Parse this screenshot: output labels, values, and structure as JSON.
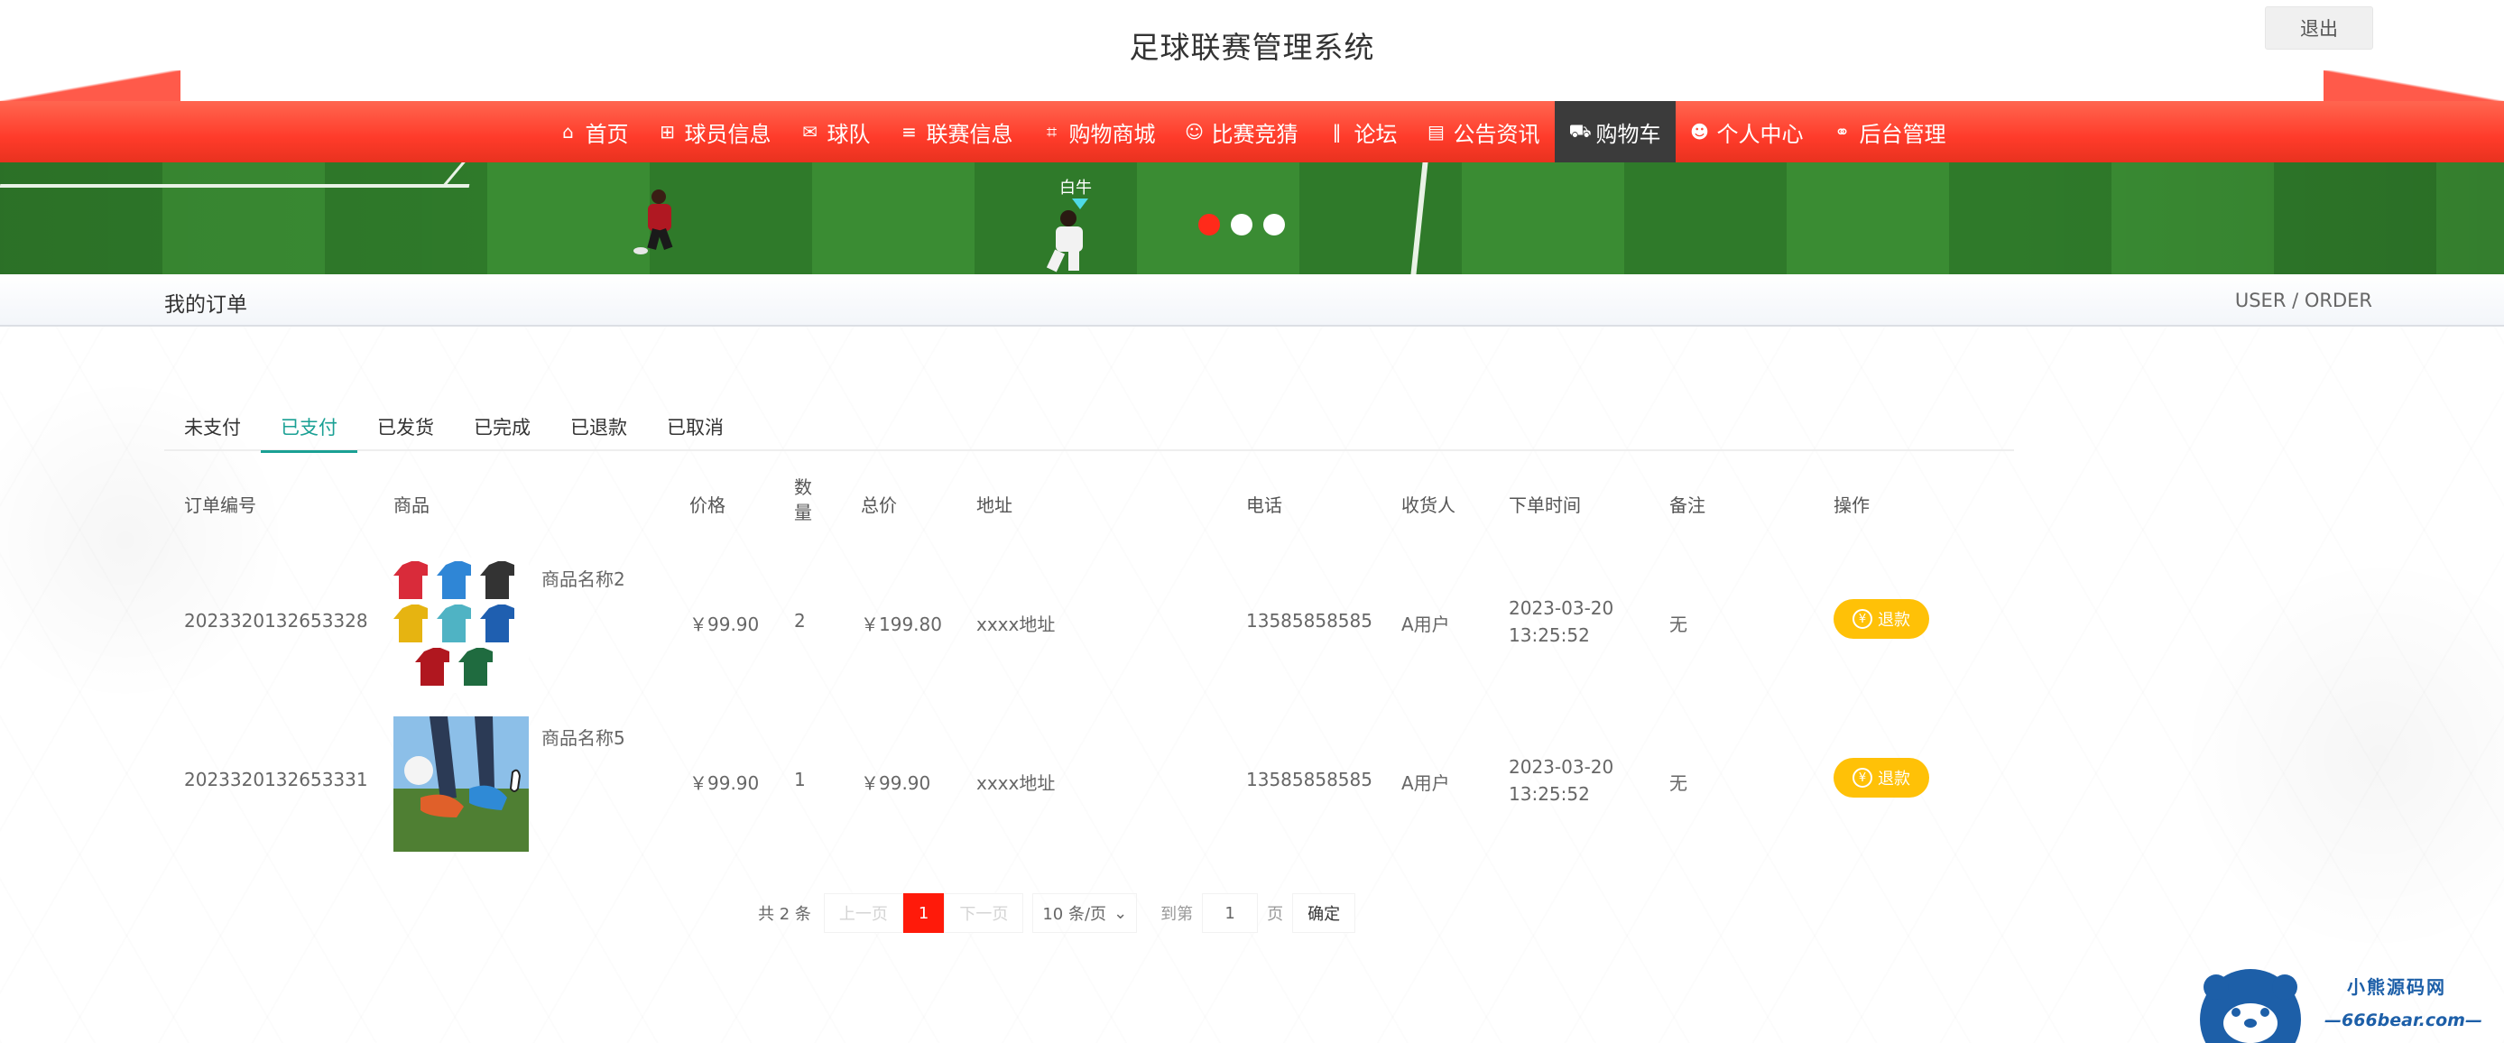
{
  "header": {
    "title": "足球联赛管理系统",
    "logout_label": "退出"
  },
  "nav": {
    "items": [
      {
        "label": "首页",
        "icon": "home-icon",
        "glyph": "⌂"
      },
      {
        "label": "球员信息",
        "icon": "gift-icon",
        "glyph": "⊞"
      },
      {
        "label": "球队",
        "icon": "mail-icon",
        "glyph": "✉"
      },
      {
        "label": "联赛信息",
        "icon": "sliders-icon",
        "glyph": "≡"
      },
      {
        "label": "购物商城",
        "icon": "tag-icon",
        "glyph": "⌗"
      },
      {
        "label": "比赛竞猜",
        "icon": "gamepad-icon",
        "glyph": "☺"
      },
      {
        "label": "论坛",
        "icon": "columns-icon",
        "glyph": "‖"
      },
      {
        "label": "公告资讯",
        "icon": "book-icon",
        "glyph": "▤"
      },
      {
        "label": "购物车",
        "icon": "cart-icon",
        "glyph": "⛟"
      },
      {
        "label": "个人中心",
        "icon": "user-icon",
        "glyph": "☻"
      },
      {
        "label": "后台管理",
        "icon": "link-icon",
        "glyph": "⚭"
      }
    ],
    "active_index": 8
  },
  "banner": {
    "player_tag": "白牛"
  },
  "breadcrumb": {
    "title": "我的订单",
    "path": "USER / ORDER"
  },
  "tabs": {
    "items": [
      "未支付",
      "已支付",
      "已发货",
      "已完成",
      "已退款",
      "已取消"
    ],
    "active_index": 1
  },
  "table": {
    "headers": {
      "order_no": "订单编号",
      "product": "商品",
      "price": "价格",
      "qty": "数量",
      "total": "总价",
      "address": "地址",
      "phone": "电话",
      "receiver": "收货人",
      "order_time": "下单时间",
      "note": "备注",
      "action": "操作"
    },
    "rows": [
      {
        "order_no": "2023320132653328",
        "product_name": "商品名称2",
        "price": "￥99.90",
        "qty": "2",
        "total": "￥199.80",
        "address": "xxxx地址",
        "phone": "13585858585",
        "receiver": "A用户",
        "order_date": "2023-03-20",
        "order_clock": "13:25:52",
        "note": "无",
        "action_label": "退款"
      },
      {
        "order_no": "2023320132653331",
        "product_name": "商品名称5",
        "price": "￥99.90",
        "qty": "1",
        "total": "￥99.90",
        "address": "xxxx地址",
        "phone": "13585858585",
        "receiver": "A用户",
        "order_date": "2023-03-20",
        "order_clock": "13:25:52",
        "note": "无",
        "action_label": "退款"
      }
    ]
  },
  "pagination": {
    "total_text": "共 2 条",
    "prev_label": "上一页",
    "current_page": "1",
    "next_label": "下一页",
    "page_size_label": "10 条/页",
    "goto_label": "到第",
    "goto_value": "1",
    "page_unit": "页",
    "confirm_label": "确定"
  },
  "watermark": {
    "line1": "小熊源码网",
    "line2": "—666bear.com—"
  },
  "colors": {
    "nav_red": "#ff3b2a",
    "nav_active": "#3b3b3b",
    "tab_active": "#1aa094",
    "refund_button": "#ffc107",
    "pager_current": "#ff1a0a"
  }
}
